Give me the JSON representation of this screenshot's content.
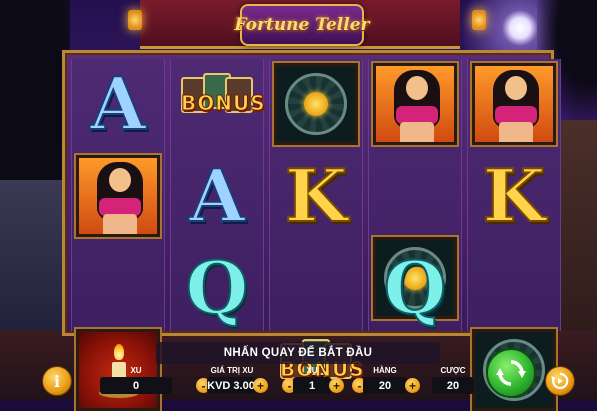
{
  "game": {
    "title": "Fortune Teller"
  },
  "reels": [
    [
      "letter-a",
      "lady",
      "candle"
    ],
    [
      "bonus",
      "letter-a",
      "letter-q"
    ],
    [
      "wheel",
      "letter-k",
      "bonus"
    ],
    [
      "lady",
      "wheel",
      "letter-q"
    ],
    [
      "lady",
      "letter-k",
      "wheel"
    ]
  ],
  "symbols": {
    "a": "A",
    "k": "K",
    "q": "Q",
    "bonus": "BONUS"
  },
  "status": {
    "message": "NHẤN QUAY ĐỂ BẮT ĐẦU"
  },
  "controls": {
    "info_icon": "i",
    "coins": {
      "label": "XU",
      "value": "0"
    },
    "coin_value": {
      "label": "GIÁ TRỊ XU",
      "value": "KVD 3.00"
    },
    "xu": {
      "label": "XU",
      "value": "1"
    },
    "lines": {
      "label": "HÀNG",
      "value": "20"
    },
    "bet": {
      "label": "CƯỢC",
      "value": "20"
    },
    "minus": "-",
    "plus": "+"
  },
  "icons": {
    "info": "info-icon",
    "spin": "spin-arrows-icon",
    "autoplay": "autoplay-icon"
  },
  "colors": {
    "spin_green": "#2eb52e",
    "accent_gold": "#e89a12",
    "letter_a": "#9ed2ff",
    "letter_k": "#ffd34a",
    "letter_q": "#7ef0ea"
  }
}
